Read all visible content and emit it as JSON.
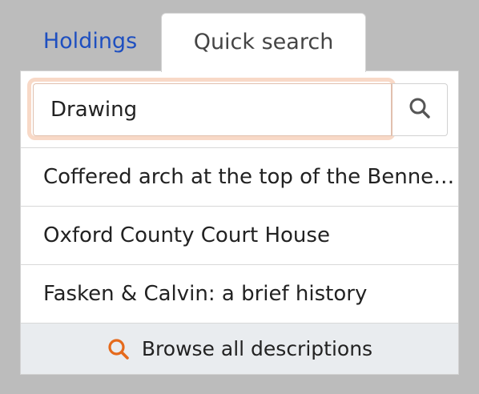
{
  "tabs": {
    "holdings_label": "Holdings",
    "quick_search_label": "Quick search"
  },
  "search": {
    "value": "Drawing",
    "button_icon": "search-icon"
  },
  "results": [
    {
      "title": "Coffered arch at the top of the Bennett Building"
    },
    {
      "title": "Oxford County Court House"
    },
    {
      "title": "Fasken & Calvin: a brief history"
    }
  ],
  "browse_all": {
    "label": "Browse all descriptions",
    "icon": "search-icon",
    "icon_color": "#e56a1c"
  },
  "colors": {
    "link_blue": "#1e4fc0",
    "focus_ring": "#f8d9c7",
    "footer_bg": "#e9ecef",
    "page_bg": "#bcbcbc"
  }
}
